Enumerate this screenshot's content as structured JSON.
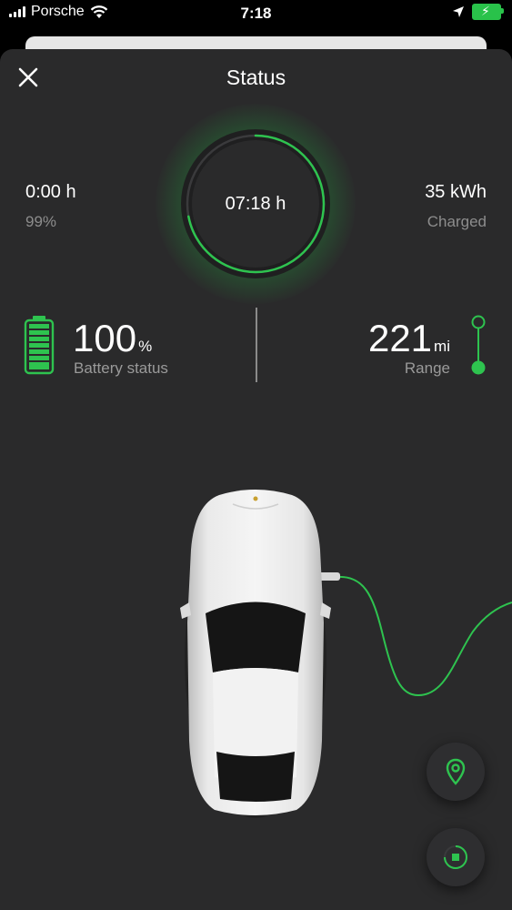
{
  "status_bar": {
    "carrier": "Porsche",
    "time": "7:18"
  },
  "header": {
    "title": "Status"
  },
  "charging": {
    "timer": "07:18 h",
    "timer_progress": 0.72,
    "remaining_time": "0:00 h",
    "target_percent": "99%",
    "energy": "35 kWh",
    "energy_label": "Charged"
  },
  "battery": {
    "value": "100",
    "unit": "%",
    "label": "Battery status"
  },
  "range": {
    "value": "221",
    "unit": "mi",
    "label": "Range"
  },
  "icons": {
    "close": "close-icon",
    "location": "location-pin-icon",
    "stop": "stop-charging-icon"
  },
  "colors": {
    "accent": "#2ec34f",
    "background": "#2a2a2b",
    "secondary_text": "#8d8d8d"
  }
}
